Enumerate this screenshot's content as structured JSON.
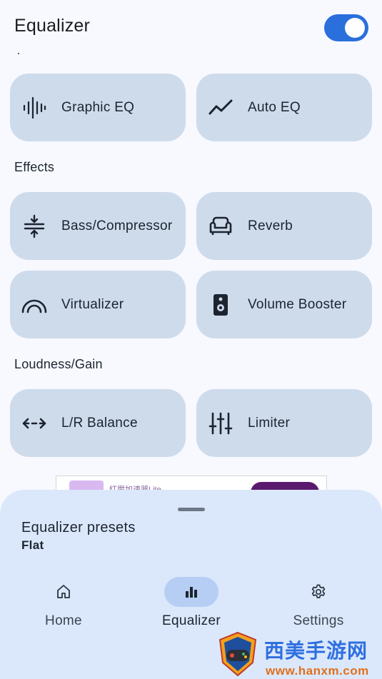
{
  "header": {
    "title": "Equalizer",
    "enabled": true
  },
  "top_cards": [
    {
      "label": "Graphic EQ",
      "icon": "waveform-icon"
    },
    {
      "label": "Auto EQ",
      "icon": "trend-line-icon"
    }
  ],
  "sections": {
    "effects": "Effects",
    "loudness": "Loudness/Gain"
  },
  "effects_cards": [
    {
      "label": "Bass/Compressor",
      "icon": "compress-icon"
    },
    {
      "label": "Reverb",
      "icon": "armchair-icon"
    },
    {
      "label": "Virtualizer",
      "icon": "arc-icon"
    },
    {
      "label": "Volume Booster",
      "icon": "speaker-icon"
    }
  ],
  "loudness_cards": [
    {
      "label": "L/R Balance",
      "icon": "arrows-left-right-icon"
    },
    {
      "label": "Limiter",
      "icon": "sliders-icon"
    }
  ],
  "ad": {
    "text": "红魔加速器Lite"
  },
  "presets": {
    "title": "Equalizer presets",
    "value": "Flat"
  },
  "nav": [
    {
      "label": "Home",
      "icon": "home-icon",
      "active": false
    },
    {
      "label": "Equalizer",
      "icon": "bar-chart-icon",
      "active": true
    },
    {
      "label": "Settings",
      "icon": "gear-icon",
      "active": false
    }
  ],
  "watermark": {
    "cn": "西美手游网",
    "url": "www.hanxm.com"
  },
  "colors": {
    "accent": "#2a6fdc",
    "card": "#cedbeb",
    "sheet": "#dbe8fb",
    "nav_active": "#b6cef3",
    "background": "#f7f9ff"
  }
}
